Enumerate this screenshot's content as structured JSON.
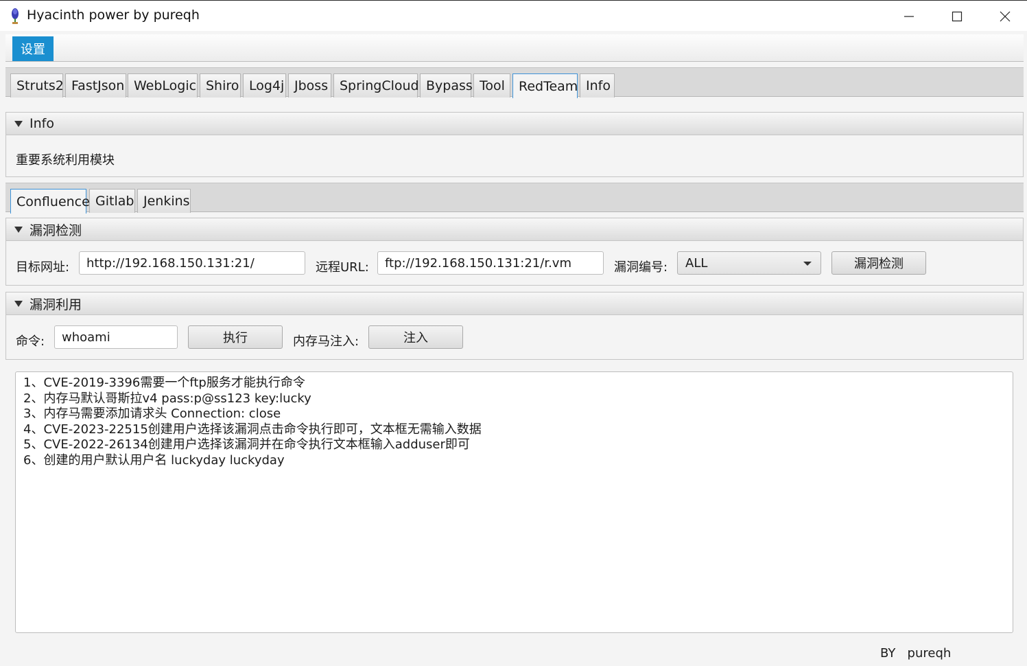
{
  "window": {
    "title": "Hyacinth power by pureqh",
    "icon": "hyacinth-app-icon",
    "controls": [
      "minimize-icon",
      "maximize-icon",
      "close-icon"
    ]
  },
  "menubar": {
    "settings": "设置"
  },
  "main_tabs": [
    "Struts2",
    "FastJson",
    "WebLogic",
    "Shiro",
    "Log4j",
    "Jboss",
    "SpringCloud",
    "Bypass",
    "Tool",
    "RedTeam",
    "Info"
  ],
  "active_main_tab": "RedTeam",
  "info_pane": {
    "title": "Info",
    "text": "重要系统利用模块"
  },
  "sub_tabs": [
    "Confluence",
    "Gitlab",
    "Jenkins"
  ],
  "active_sub_tab": "Confluence",
  "detect_pane": {
    "title": "漏洞检测",
    "target_label": "目标网址:",
    "target_value": "http://192.168.150.131:21/",
    "remote_label": "远程URL:",
    "remote_value": "ftp://192.168.150.131:21/r.vm",
    "vuln_label": "漏洞编号:",
    "vuln_selected": "ALL",
    "detect_button": "漏洞检测"
  },
  "exploit_pane": {
    "title": "漏洞利用",
    "cmd_label": "命令:",
    "cmd_value": "whoami",
    "exec_button": "执行",
    "inject_label": "内存马注入:",
    "inject_button": "注入"
  },
  "output_lines": [
    "1、CVE-2019-3396需要一个ftp服务才能执行命令",
    "2、内存马默认哥斯拉v4 pass:p@ss123 key:lucky",
    "3、内存马需要添加请求头 Connection: close",
    "4、CVE-2023-22515创建用户选择该漏洞点击命令执行即可，文本框无需输入数据",
    "5、CVE-2022-26134创建用户选择该漏洞并在命令执行文本框输入adduser即可",
    "6、创建的用户默认用户名 luckyday luckyday"
  ],
  "footer": "BY   pureqh",
  "colors": {
    "accent": "#1a8fd0",
    "active_tab_border": "#3e93d8"
  }
}
